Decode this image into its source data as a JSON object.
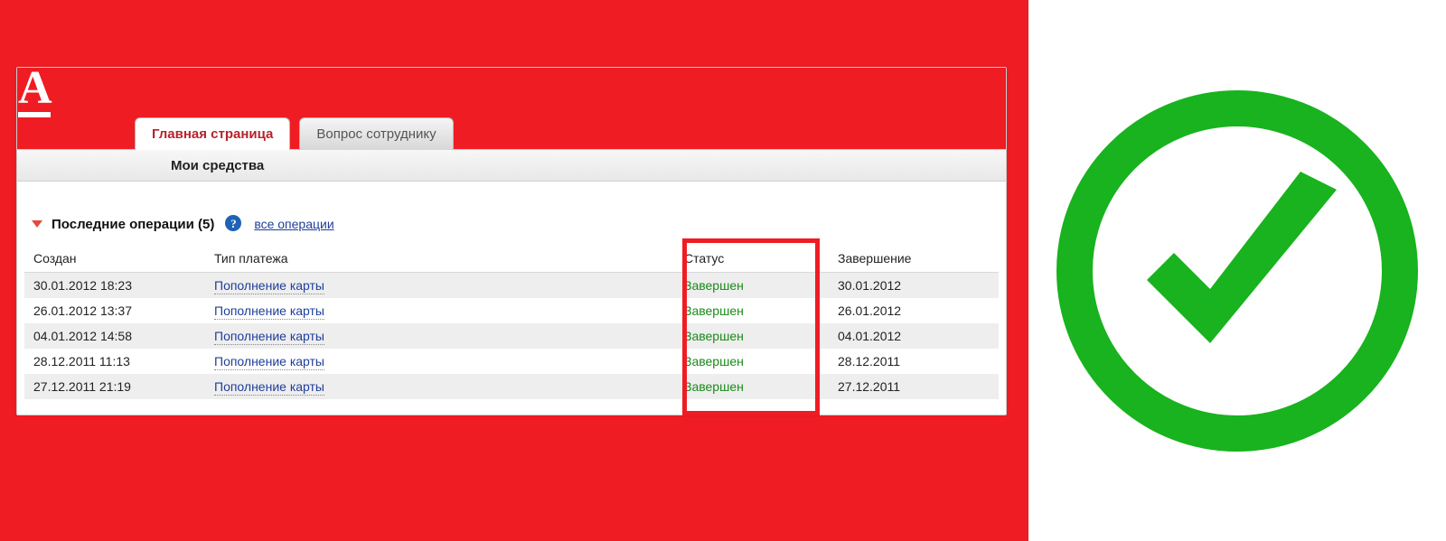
{
  "tabs": {
    "active": "Главная страница",
    "inactive": "Вопрос сотруднику"
  },
  "section": {
    "title": "Мои средства"
  },
  "ops": {
    "heading": "Последние операции (5)",
    "help_char": "?",
    "all_link": "все операции",
    "columns": {
      "created": "Создан",
      "type": "Тип платежа",
      "status": "Статус",
      "end": "Завершение"
    },
    "rows": [
      {
        "created": "30.01.2012 18:23",
        "type": "Пополнение карты",
        "status": "Завершен",
        "end": "30.01.2012"
      },
      {
        "created": "26.01.2012 13:37",
        "type": "Пополнение карты",
        "status": "Завершен",
        "end": "26.01.2012"
      },
      {
        "created": "04.01.2012 14:58",
        "type": "Пополнение карты",
        "status": "Завершен",
        "end": "04.01.2012"
      },
      {
        "created": "28.12.2011 11:13",
        "type": "Пополнение карты",
        "status": "Завершен",
        "end": "28.12.2011"
      },
      {
        "created": "27.12.2011 21:19",
        "type": "Пополнение карты",
        "status": "Завершен",
        "end": "27.12.2011"
      }
    ]
  },
  "logo": {
    "letter": "A"
  }
}
